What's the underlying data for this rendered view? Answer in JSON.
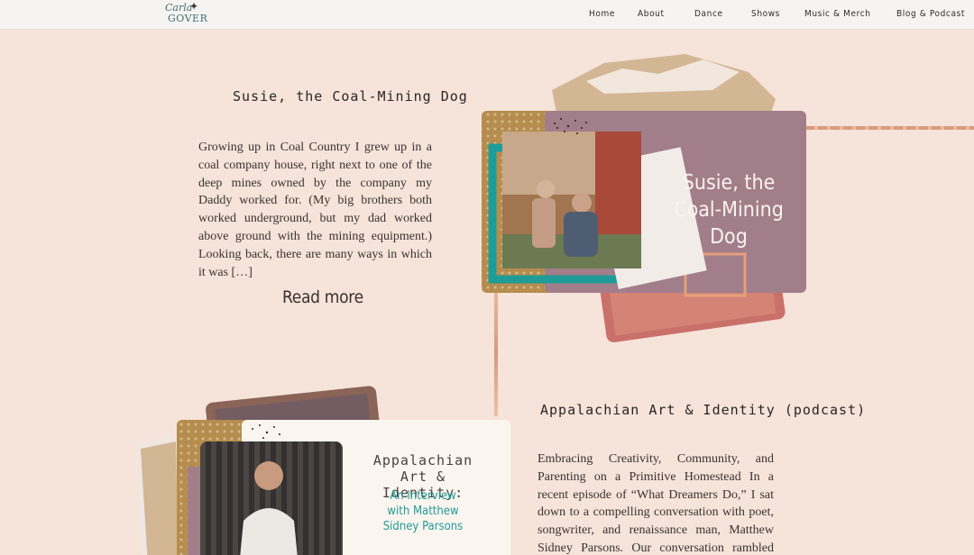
{
  "header": {
    "logo_line1": "Carla",
    "logo_line2": "GOVER",
    "nav": [
      {
        "label": "Home"
      },
      {
        "label": "About"
      },
      {
        "label": "Dance"
      },
      {
        "label": "Shows"
      },
      {
        "label": "Music & Merch"
      },
      {
        "label": "Blog & Podcast"
      }
    ]
  },
  "posts": [
    {
      "title": "Susie, the Coal-Mining Dog",
      "excerpt": "Growing up in Coal Country I grew up in a coal company house, right next to one of the deep mines owned by the company my Daddy worked for. (My big brothers both worked underground, but my dad worked above ground with the mining equipment.) Looking back, there are many ways in which it was […]",
      "read_more": "Read more",
      "image_title": "Susie, the Coal-Mining Dog"
    },
    {
      "title": "Appalachian Art & Identity (podcast)",
      "excerpt": "Embracing Creativity, Community, and Parenting on a Primitive Homestead In a recent episode of “What Dreamers Do,” I sat down to a compelling conversation with poet, songwriter, and renaissance man, Matthew Sidney Parsons. Our conversation rambled naturally into Parsons’",
      "image_title": "Appalachian Art & Identity:",
      "image_subtitle": "An Interview with Matthew Sidney Parsons"
    }
  ],
  "colors": {
    "background": "#f6e3d9",
    "accent_teal": "#1f9c97",
    "mauve": "#a27e8a"
  }
}
